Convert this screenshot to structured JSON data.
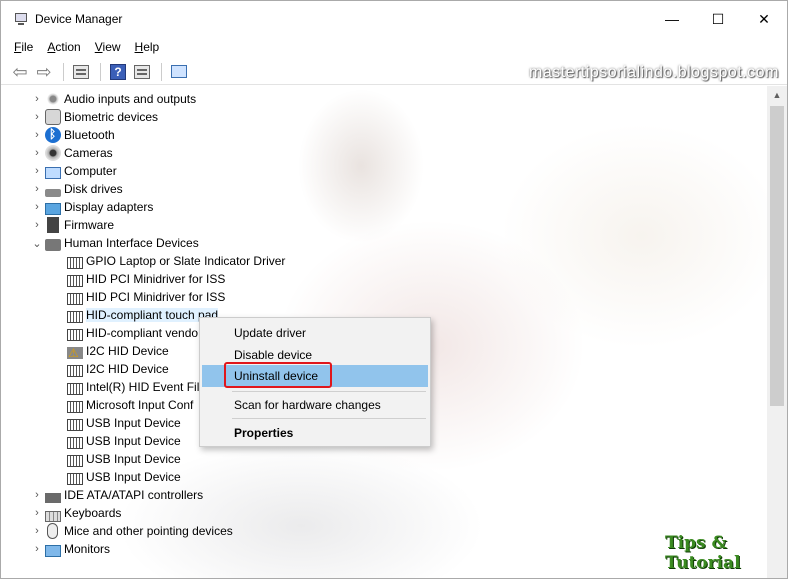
{
  "window": {
    "title": "Device Manager",
    "controls": {
      "minimize": "—",
      "maximize": "☐",
      "close": "✕"
    }
  },
  "menu": [
    {
      "first": "F",
      "rest": "ile"
    },
    {
      "first": "A",
      "rest": "ction"
    },
    {
      "first": "V",
      "rest": "iew"
    },
    {
      "first": "H",
      "rest": "elp"
    }
  ],
  "toolbar": {
    "back": "⇦",
    "forward": "⇨",
    "help": "?"
  },
  "tree": {
    "categories_top": [
      {
        "label": "Audio inputs and outputs",
        "icon": "audio-icon"
      },
      {
        "label": "Biometric devices",
        "icon": "biometric-icon"
      },
      {
        "label": "Bluetooth",
        "icon": "bluetooth-icon"
      },
      {
        "label": "Cameras",
        "icon": "camera-icon"
      },
      {
        "label": "Computer",
        "icon": "computer-icon"
      },
      {
        "label": "Disk drives",
        "icon": "disk-icon"
      },
      {
        "label": "Display adapters",
        "icon": "display-icon"
      },
      {
        "label": "Firmware",
        "icon": "firmware-icon"
      }
    ],
    "expanded": {
      "label": "Human Interface Devices",
      "icon": "hid-icon"
    },
    "children": [
      {
        "label": "GPIO Laptop or Slate Indicator Driver",
        "warn": false
      },
      {
        "label": "HID PCI Minidriver for ISS",
        "warn": false
      },
      {
        "label": "HID PCI Minidriver for ISS",
        "warn": false
      },
      {
        "label": "HID-compliant touch pad",
        "warn": false
      },
      {
        "label": "HID-compliant vendo",
        "warn": false
      },
      {
        "label": "I2C HID Device",
        "warn": true
      },
      {
        "label": "I2C HID Device",
        "warn": false
      },
      {
        "label": "Intel(R) HID Event Filt",
        "warn": false
      },
      {
        "label": "Microsoft Input Conf",
        "warn": false
      },
      {
        "label": "USB Input Device",
        "warn": false
      },
      {
        "label": "USB Input Device",
        "warn": false
      },
      {
        "label": "USB Input Device",
        "warn": false
      },
      {
        "label": "USB Input Device",
        "warn": false
      }
    ],
    "categories_bottom": [
      {
        "label": "IDE ATA/ATAPI controllers",
        "icon": "ide-icon"
      },
      {
        "label": "Keyboards",
        "icon": "keyboard-icon"
      },
      {
        "label": "Mice and other pointing devices",
        "icon": "mouse-icon"
      },
      {
        "label": "Monitors",
        "icon": "monitor-icon"
      }
    ]
  },
  "context_menu": {
    "update": "Update driver",
    "disable": "Disable device",
    "uninstall": "Uninstall device",
    "scan": "Scan for hardware changes",
    "properties": "Properties"
  },
  "watermarks": {
    "site": "mastertipsorialindo.blogspot.com",
    "badge": "Tips & Tutorial"
  }
}
